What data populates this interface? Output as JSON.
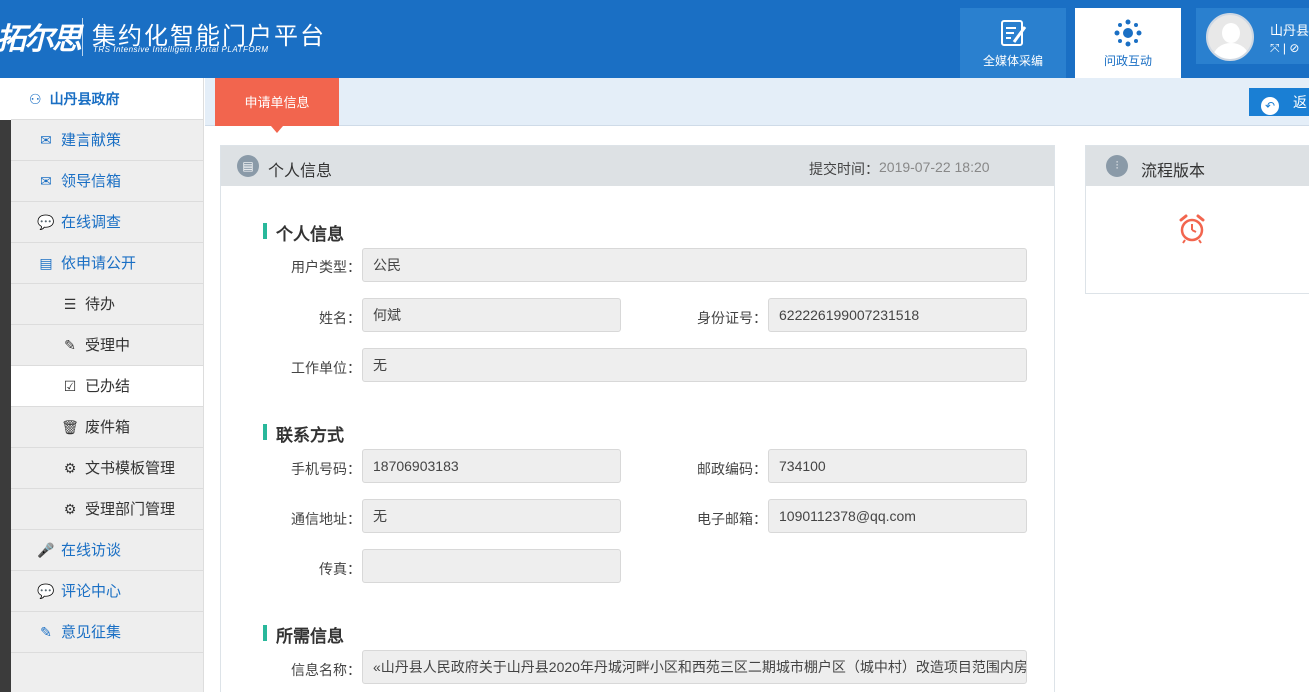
{
  "header": {
    "logo_text": "拓尔思",
    "title": "集约化智能门户平台",
    "subtitle": "TRS Intensive Intelligent Portal PLATFORM",
    "nav": [
      {
        "label": "全媒体采编",
        "icon": "media-edit-icon"
      },
      {
        "label": "问政互动",
        "icon": "interaction-icon"
      }
    ],
    "user": {
      "name": "山丹县",
      "icons": "⤧ | ⊘"
    }
  },
  "sidebar": {
    "head": "山丹县政府",
    "items": [
      {
        "label": "建言献策",
        "icon": "✉",
        "level": 1
      },
      {
        "label": "领导信箱",
        "icon": "✉",
        "level": 1
      },
      {
        "label": "在线调查",
        "icon": "💬",
        "level": 1
      },
      {
        "label": "依申请公开",
        "icon": "▤",
        "level": 1
      },
      {
        "label": "待办",
        "icon": "☰",
        "level": 2
      },
      {
        "label": "受理中",
        "icon": "✎",
        "level": 2
      },
      {
        "label": "已办结",
        "icon": "☑",
        "level": 2,
        "active": true
      },
      {
        "label": "废件箱",
        "icon": "🗑",
        "level": 2
      },
      {
        "label": "文书模板管理",
        "icon": "⚙",
        "level": 2
      },
      {
        "label": "受理部门管理",
        "icon": "⚙",
        "level": 2
      },
      {
        "label": "在线访谈",
        "icon": "🎤",
        "level": 1
      },
      {
        "label": "评论中心",
        "icon": "💬",
        "level": 1
      },
      {
        "label": "意见征集",
        "icon": "✎",
        "level": 1
      }
    ]
  },
  "tabbar": {
    "active_tab": "申请单信息",
    "back_label": "返"
  },
  "panel": {
    "title": "个人信息",
    "submit_time_label": "提交时间：",
    "submit_time": "2019-07-22 18:20",
    "sections": {
      "personal": "个人信息",
      "contact": "联系方式",
      "required": "所需信息"
    },
    "fields": {
      "user_type": {
        "label": "用户类型：",
        "value": "公民"
      },
      "name": {
        "label": "姓名：",
        "value": "何斌"
      },
      "id_number": {
        "label": "身份证号：",
        "value": "622226199007231518"
      },
      "employer": {
        "label": "工作单位：",
        "value": "无"
      },
      "phone": {
        "label": "手机号码：",
        "value": "18706903183"
      },
      "postcode": {
        "label": "邮政编码：",
        "value": "734100"
      },
      "address": {
        "label": "通信地址：",
        "value": "无"
      },
      "email": {
        "label": "电子邮箱：",
        "value": "1090112378@qq.com"
      },
      "fax": {
        "label": "传真：",
        "value": ""
      },
      "info_name": {
        "label": "信息名称：",
        "value": "«山丹县人民政府关于山丹县2020年丹城河畔小区和西苑三区二期城市棚户区（城中村）改造项目范围内房屋进行"
      }
    }
  },
  "right_panel": {
    "title": "流程版本"
  },
  "colors": {
    "header_blue": "#1a6fc4",
    "tab_red": "#f2654e",
    "accent_green": "#29b89b"
  }
}
